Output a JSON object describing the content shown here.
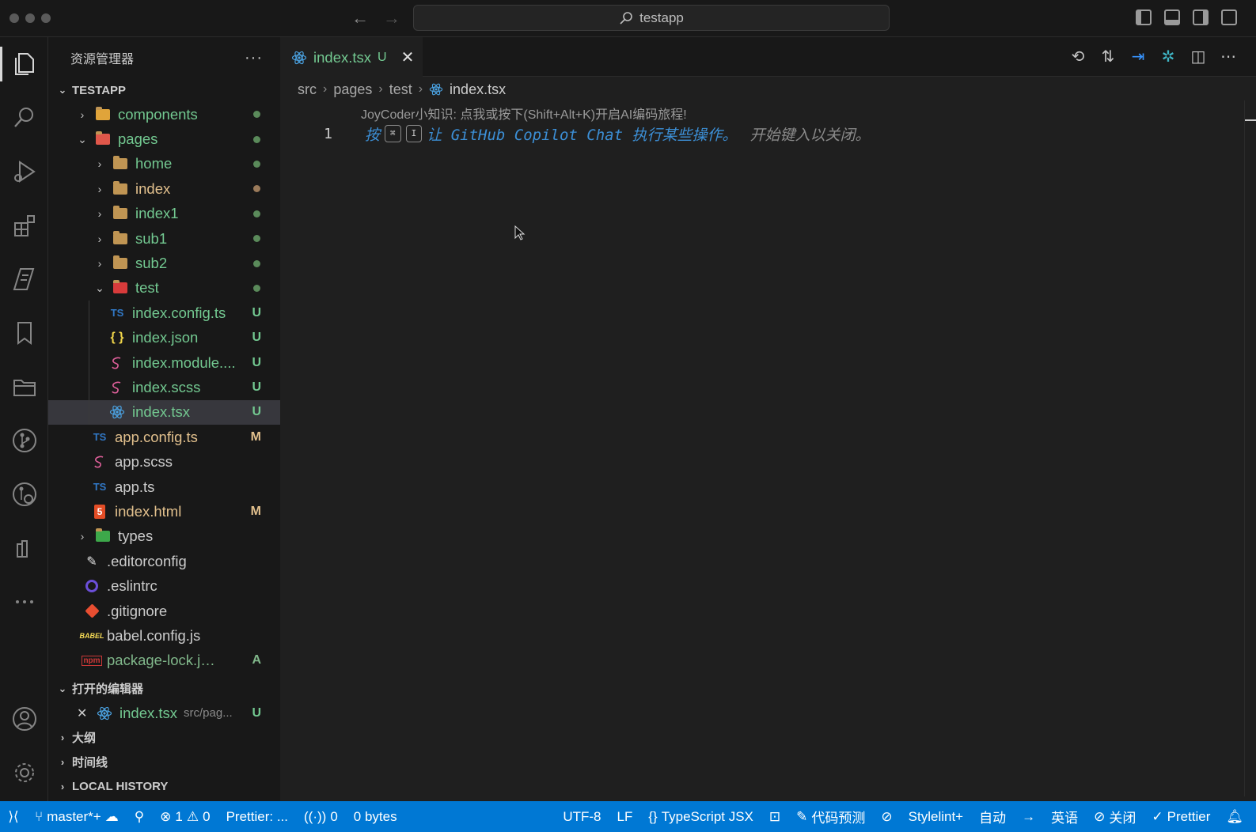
{
  "titlebar": {
    "search_text": "testapp"
  },
  "sidebar": {
    "title": "资源管理器",
    "more": "···",
    "project": "TESTAPP",
    "tree": [
      {
        "name": "components",
        "depth": 1,
        "type": "folder-special",
        "chevron": "›",
        "color": "green",
        "status": "dot"
      },
      {
        "name": "pages",
        "depth": 1,
        "type": "folder-special-red",
        "chevron": "⌄",
        "color": "green",
        "status": "dot"
      },
      {
        "name": "home",
        "depth": 2,
        "type": "folder",
        "chevron": "›",
        "color": "green",
        "status": "dot"
      },
      {
        "name": "index",
        "depth": 2,
        "type": "folder",
        "chevron": "›",
        "color": "mod",
        "status": "dot-mod"
      },
      {
        "name": "index1",
        "depth": 2,
        "type": "folder",
        "chevron": "›",
        "color": "green",
        "status": "dot"
      },
      {
        "name": "sub1",
        "depth": 2,
        "type": "folder",
        "chevron": "›",
        "color": "green",
        "status": "dot"
      },
      {
        "name": "sub2",
        "depth": 2,
        "type": "folder",
        "chevron": "›",
        "color": "green",
        "status": "dot"
      },
      {
        "name": "test",
        "depth": 2,
        "type": "folder-test",
        "chevron": "⌄",
        "color": "green",
        "status": "dot"
      },
      {
        "name": "index.config.ts",
        "depth": 3,
        "type": "ts",
        "color": "green",
        "badge": "U"
      },
      {
        "name": "index.json",
        "depth": 3,
        "type": "json",
        "color": "green",
        "badge": "U"
      },
      {
        "name": "index.module....",
        "depth": 3,
        "type": "scss",
        "color": "green",
        "badge": "U"
      },
      {
        "name": "index.scss",
        "depth": 3,
        "type": "scss",
        "color": "green",
        "badge": "U"
      },
      {
        "name": "index.tsx",
        "depth": 3,
        "type": "react",
        "color": "green",
        "badge": "U",
        "selected": true
      },
      {
        "name": "app.config.ts",
        "depth": 2,
        "type": "ts",
        "color": "mod",
        "badge": "M"
      },
      {
        "name": "app.scss",
        "depth": 2,
        "type": "scss",
        "color": "plain"
      },
      {
        "name": "app.ts",
        "depth": 2,
        "type": "ts",
        "color": "plain"
      },
      {
        "name": "index.html",
        "depth": 2,
        "type": "html",
        "color": "mod",
        "badge": "M"
      },
      {
        "name": "types",
        "depth": 1,
        "type": "folder-ts",
        "chevron": "›",
        "color": "plain"
      },
      {
        "name": ".editorconfig",
        "depth": 1,
        "type": "editorconfig",
        "color": "plain"
      },
      {
        "name": ".eslintrc",
        "depth": 1,
        "type": "eslint",
        "color": "plain"
      },
      {
        "name": ".gitignore",
        "depth": 1,
        "type": "git",
        "color": "plain"
      },
      {
        "name": "babel.config.js",
        "depth": 1,
        "type": "babel",
        "color": "plain"
      },
      {
        "name": "package-lock.json",
        "depth": 1,
        "type": "npm",
        "color": "added",
        "badge": "A"
      }
    ],
    "open_editors": {
      "title": "打开的编辑器",
      "item": {
        "close": "✕",
        "name": "index.tsx",
        "path": "src/pag...",
        "badge": "U"
      }
    },
    "outline": "大纲",
    "timeline": "时间线",
    "local_history": "LOCAL HISTORY"
  },
  "editor": {
    "tab": {
      "name": "index.tsx",
      "badge": "U",
      "close": "✕"
    },
    "breadcrumb": [
      "src",
      "pages",
      "test",
      "index.tsx"
    ],
    "hint": "JoyCoder小知识: 点我或按下(Shift+Alt+K)开启AI编码旅程!",
    "line_number": "1",
    "ghost": {
      "press": "按",
      "key1": "⌘",
      "key2": "I",
      "text": "让 GitHub Copilot Chat 执行某些操作。",
      "dismiss": "开始键入以关闭。"
    }
  },
  "statusbar": {
    "remote": "⟩⟨",
    "branch": "master*+",
    "errors": "1",
    "warnings": "0",
    "prettier_short": "Prettier: ...",
    "ports": "0",
    "size": "0 bytes",
    "encoding": "UTF-8",
    "eol": "LF",
    "language": "TypeScript JSX",
    "code_predict": "代码预测",
    "stylelint": "Stylelint+",
    "auto": "自动",
    "lang_en": "英语",
    "close": "关闭",
    "prettier": "Prettier"
  },
  "colors": {
    "accent": "#0078d4",
    "git_untracked": "#73c991",
    "git_modified": "#e2c08d",
    "git_added": "#81b88b"
  }
}
